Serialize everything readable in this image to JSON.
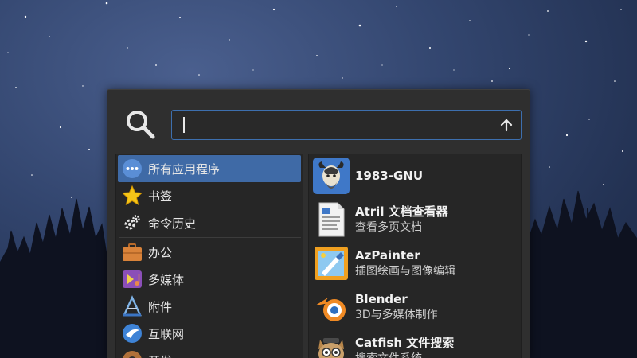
{
  "search": {
    "placeholder": "",
    "value": ""
  },
  "categories": [
    {
      "label": "所有应用程序",
      "icon": "all-apps-icon",
      "active": true
    },
    {
      "label": "书签",
      "icon": "star-icon",
      "active": false
    },
    {
      "label": "命令历史",
      "icon": "gears-icon",
      "active": false
    },
    {
      "label": "办公",
      "icon": "briefcase-icon",
      "active": false
    },
    {
      "label": "多媒体",
      "icon": "multimedia-icon",
      "active": false
    },
    {
      "label": "附件",
      "icon": "accessories-icon",
      "active": false
    },
    {
      "label": "互联网",
      "icon": "internet-icon",
      "active": false
    },
    {
      "label": "开发",
      "icon": "development-icon",
      "active": false
    }
  ],
  "apps": [
    {
      "name": "1983-GNU",
      "description": "",
      "icon": "gnu-icon"
    },
    {
      "name": "Atril 文档查看器",
      "description": "查看多页文档",
      "icon": "document-viewer-icon"
    },
    {
      "name": "AzPainter",
      "description": "插图绘画与图像编辑",
      "icon": "azpainter-icon"
    },
    {
      "name": "Blender",
      "description": "3D与多媒体制作",
      "icon": "blender-icon"
    },
    {
      "name": "Catfish 文件搜索",
      "description": "搜索文件系统",
      "icon": "catfish-icon"
    }
  ],
  "colors": {
    "selection": "#3f6aa6",
    "input_border": "#3d6fae",
    "panel_bg": "#2f2f2f"
  }
}
